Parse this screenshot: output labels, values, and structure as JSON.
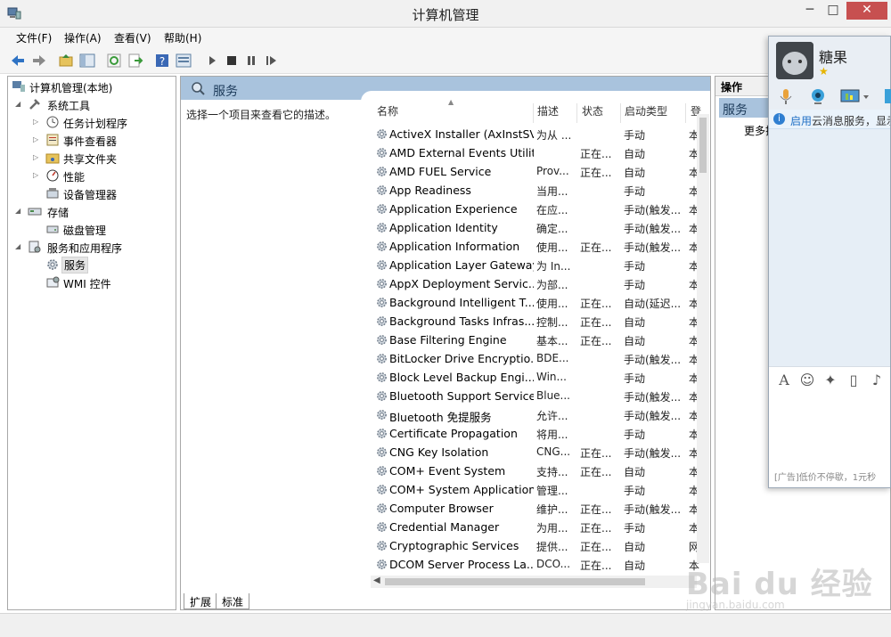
{
  "window": {
    "title": "计算机管理",
    "minimize": "─",
    "maximize": "□",
    "close": "✕"
  },
  "menu": [
    "文件(F)",
    "操作(A)",
    "查看(V)",
    "帮助(H)"
  ],
  "toolbar_icons": [
    "back-arrow-icon",
    "forward-arrow-icon",
    "up-folder-icon",
    "show-hide-tree-icon",
    "refresh-icon",
    "export-icon",
    "help-icon",
    "properties-icon",
    "play-icon",
    "stop-icon",
    "pause-icon",
    "restart-icon"
  ],
  "tree": {
    "root": "计算机管理(本地)",
    "system_tools": "系统工具",
    "task_scheduler": "任务计划程序",
    "event_viewer": "事件查看器",
    "shared_folders": "共享文件夹",
    "performance": "性能",
    "device_manager": "设备管理器",
    "storage": "存储",
    "disk_management": "磁盘管理",
    "services_apps": "服务和应用程序",
    "services": "服务",
    "wmi": "WMI 控件"
  },
  "center": {
    "header": "服务",
    "description": "选择一个项目来查看它的描述。",
    "columns": {
      "name": "名称",
      "desc": "描述",
      "status": "状态",
      "type": "启动类型",
      "login": "登"
    },
    "services": [
      {
        "name": "ActiveX Installer (AxInstSV)",
        "desc": "为从 ...",
        "status": "",
        "type": "手动",
        "login": "本"
      },
      {
        "name": "AMD External Events Utility",
        "desc": "",
        "status": "正在...",
        "type": "自动",
        "login": "本"
      },
      {
        "name": "AMD FUEL Service",
        "desc": "Prov...",
        "status": "正在...",
        "type": "自动",
        "login": "本"
      },
      {
        "name": "App Readiness",
        "desc": "当用...",
        "status": "",
        "type": "手动",
        "login": "本"
      },
      {
        "name": "Application Experience",
        "desc": "在应...",
        "status": "",
        "type": "手动(触发...",
        "login": "本"
      },
      {
        "name": "Application Identity",
        "desc": "确定...",
        "status": "",
        "type": "手动(触发...",
        "login": "本"
      },
      {
        "name": "Application Information",
        "desc": "使用...",
        "status": "正在...",
        "type": "手动(触发...",
        "login": "本"
      },
      {
        "name": "Application Layer Gateway...",
        "desc": "为 In...",
        "status": "",
        "type": "手动",
        "login": "本"
      },
      {
        "name": "AppX Deployment Servic...",
        "desc": "为部...",
        "status": "",
        "type": "手动",
        "login": "本"
      },
      {
        "name": "Background Intelligent T...",
        "desc": "使用...",
        "status": "正在...",
        "type": "自动(延迟...",
        "login": "本"
      },
      {
        "name": "Background Tasks Infras...",
        "desc": "控制...",
        "status": "正在...",
        "type": "自动",
        "login": "本"
      },
      {
        "name": "Base Filtering Engine",
        "desc": "基本...",
        "status": "正在...",
        "type": "自动",
        "login": "本"
      },
      {
        "name": "BitLocker Drive Encryptio...",
        "desc": "BDE...",
        "status": "",
        "type": "手动(触发...",
        "login": "本"
      },
      {
        "name": "Block Level Backup Engi...",
        "desc": "Win...",
        "status": "",
        "type": "手动",
        "login": "本"
      },
      {
        "name": "Bluetooth Support Service",
        "desc": "Blue...",
        "status": "",
        "type": "手动(触发...",
        "login": "本"
      },
      {
        "name": "Bluetooth 免提服务",
        "desc": "允许...",
        "status": "",
        "type": "手动(触发...",
        "login": "本"
      },
      {
        "name": "Certificate Propagation",
        "desc": "将用...",
        "status": "",
        "type": "手动",
        "login": "本"
      },
      {
        "name": "CNG Key Isolation",
        "desc": "CNG...",
        "status": "正在...",
        "type": "手动(触发...",
        "login": "本"
      },
      {
        "name": "COM+ Event System",
        "desc": "支持...",
        "status": "正在...",
        "type": "自动",
        "login": "本"
      },
      {
        "name": "COM+ System Application",
        "desc": "管理...",
        "status": "",
        "type": "手动",
        "login": "本"
      },
      {
        "name": "Computer Browser",
        "desc": "维护...",
        "status": "正在...",
        "type": "手动(触发...",
        "login": "本"
      },
      {
        "name": "Credential Manager",
        "desc": "为用...",
        "status": "正在...",
        "type": "手动",
        "login": "本"
      },
      {
        "name": "Cryptographic Services",
        "desc": "提供...",
        "status": "正在...",
        "type": "自动",
        "login": "网"
      },
      {
        "name": "DCOM Server Process La...",
        "desc": "DCO...",
        "status": "正在...",
        "type": "自动",
        "login": "本"
      }
    ]
  },
  "tabs": [
    "扩展",
    "标准"
  ],
  "actions": {
    "header": "操作",
    "section": "服务",
    "more": "更多操作"
  },
  "chat": {
    "name": "糖果",
    "star": "★",
    "notice_link": "启用",
    "notice_text": "云消息服务，显示",
    "ad": "[广告]低价不停歇，1元秒"
  },
  "watermark": {
    "text": "Bai du 经验",
    "sub": "jingyan.baidu.com"
  }
}
